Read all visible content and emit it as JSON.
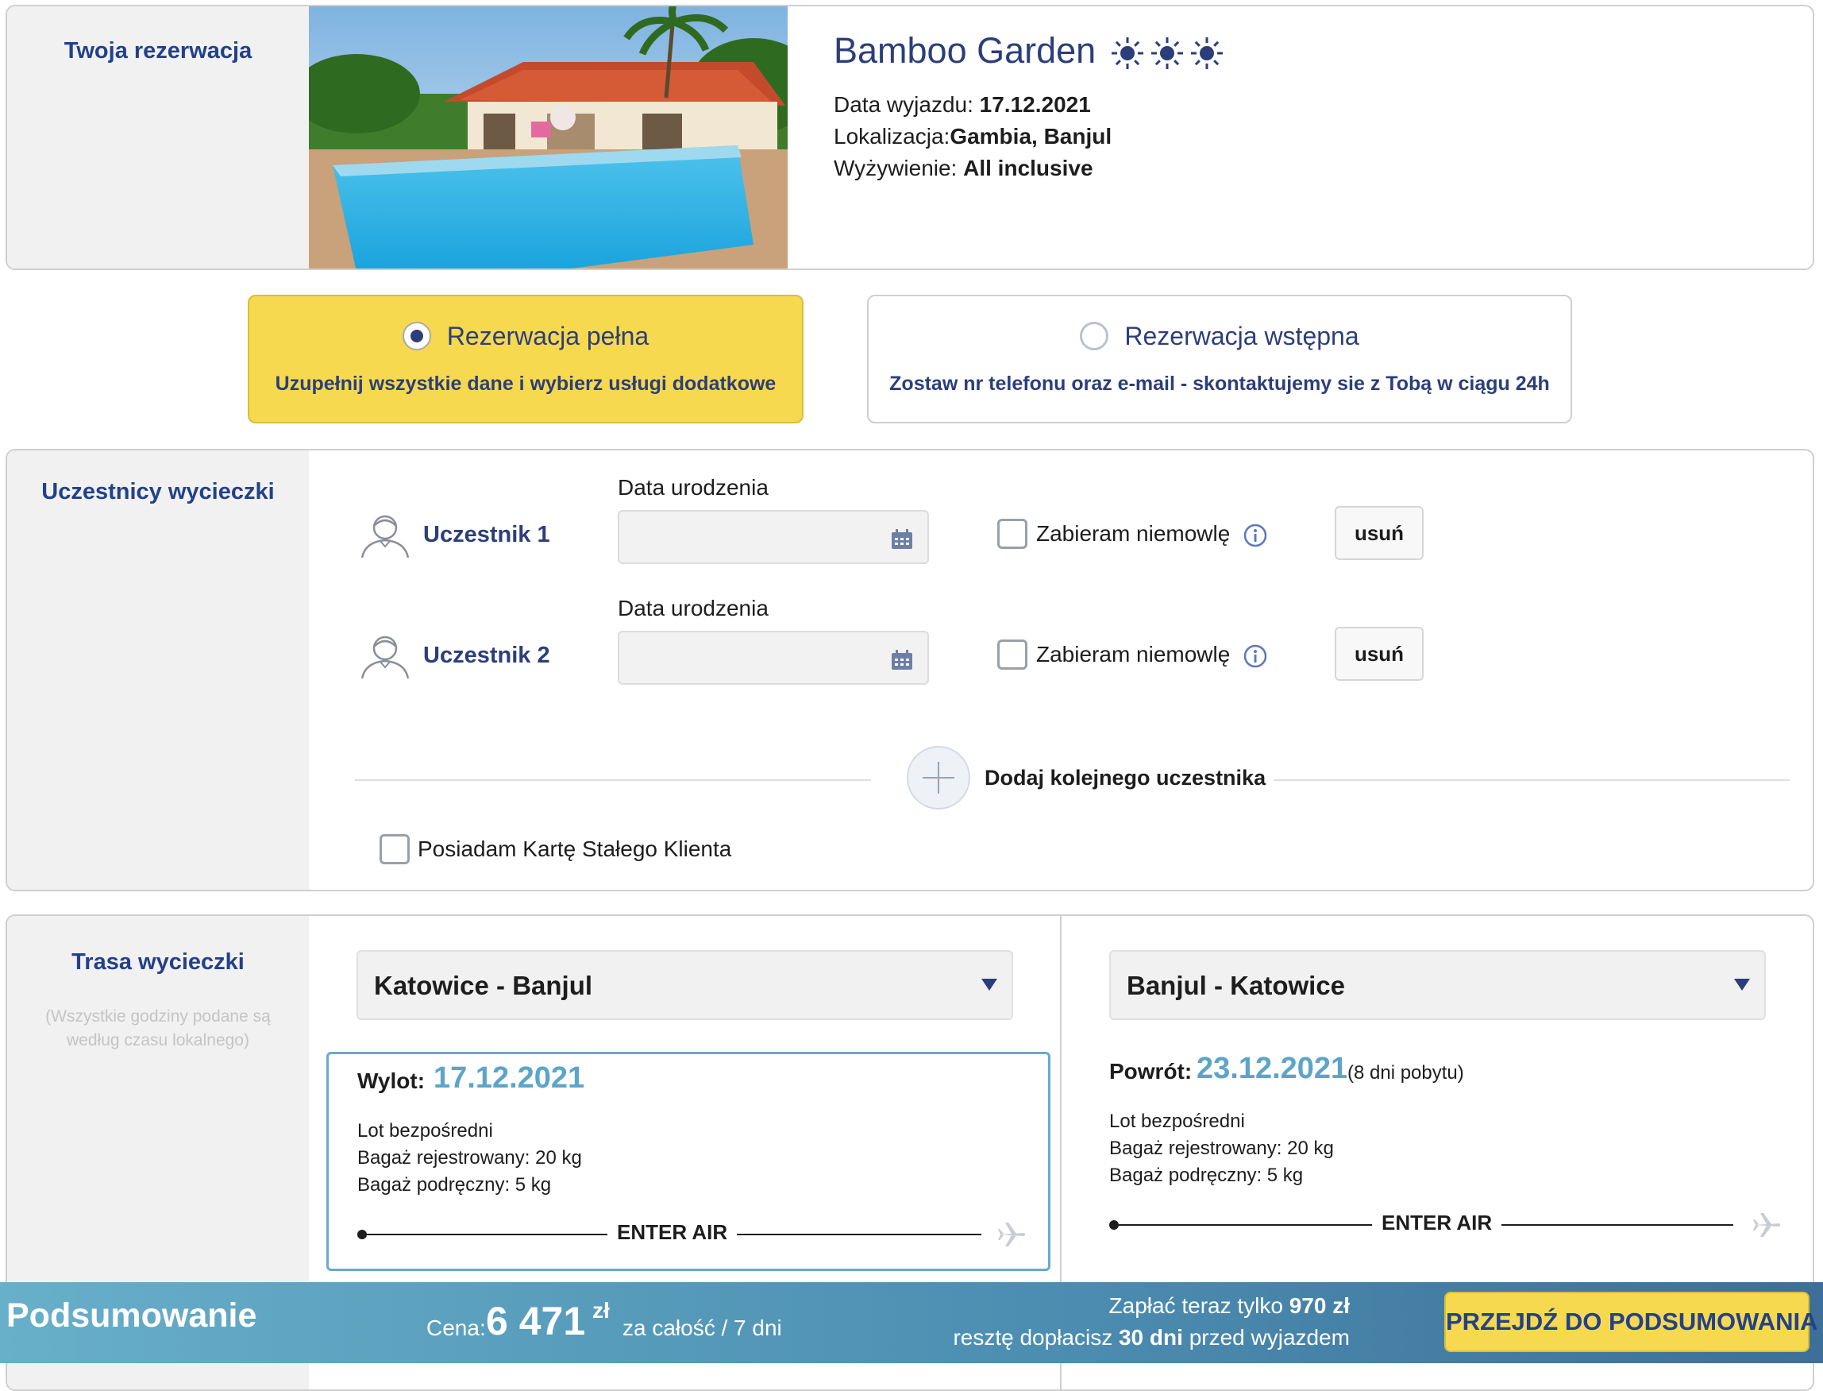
{
  "hotel": {
    "section_title": "Twoja rezerwacja",
    "name": "Bamboo Garden",
    "star_icons": [
      "sun-icon",
      "sun-icon",
      "sun-icon"
    ],
    "departure_label": "Data wyjazdu:",
    "departure_value": "17.12.2021",
    "location_label": "Lokalizacja:",
    "location_value": "Gambia, Banjul",
    "board_label": "Wyżywienie:",
    "board_value": "All inclusive"
  },
  "booking_type": {
    "full": {
      "label": "Rezerwacja pełna",
      "description": "Uzupełnij wszystkie dane i wybierz usługi dodatkowe",
      "selected": true
    },
    "preliminary": {
      "label": "Rezerwacja wstępna",
      "description": "Zostaw nr telefonu oraz e-mail - skontaktujemy sie z Tobą w ciągu 24h",
      "selected": false
    }
  },
  "participants": {
    "section_title": "Uczestnicy wycieczki",
    "items": [
      {
        "name": "Uczestnik 1",
        "dob_label": "Data urodzenia",
        "dob_value": "",
        "infant_label": "Zabieram niemowlę",
        "infant_checked": false,
        "remove_label": "usuń"
      },
      {
        "name": "Uczestnik 2",
        "dob_label": "Data urodzenia",
        "dob_value": "",
        "infant_label": "Zabieram niemowlę",
        "infant_checked": false,
        "remove_label": "usuń"
      }
    ],
    "add_label": "Dodaj kolejnego uczestnika",
    "loyalty_label": "Posiadam Kartę Stałego Klienta",
    "loyalty_checked": false
  },
  "route": {
    "section_title": "Trasa wycieczki",
    "note": "(Wszystkie godziny podane są według czasu lokalnego)",
    "outbound": {
      "select_value": "Katowice - Banjul",
      "head": "Wylot:",
      "date": "17.12.2021",
      "type": "Lot bezpośredni",
      "checked_baggage": "Bagaż rejestrowany: 20 kg",
      "hand_baggage": "Bagaż podręczny: 5 kg",
      "airline": "ENTER AIR"
    },
    "return": {
      "select_value": "Banjul - Katowice",
      "head": "Powrót:",
      "date": "23.12.2021",
      "stay": "(8 dni pobytu)",
      "type": "Lot bezpośredni",
      "checked_baggage": "Bagaż rejestrowany: 20 kg",
      "hand_baggage": "Bagaż podręczny: 5 kg",
      "airline": "ENTER AIR"
    }
  },
  "summary": {
    "title": "Podsumowanie",
    "price_label": "Cena:",
    "price_value": "6 471",
    "price_currency": "zł",
    "price_note": "za całość / 7 dni",
    "pay_now_prefix": "Zapłać teraz tylko",
    "pay_now_value": "970 zł",
    "pay_rest_prefix": "resztę dopłacisz",
    "pay_rest_value": "30 dni",
    "pay_rest_suffix": "przed wyjazdem",
    "cta_label": "PRZEJDŹ DO PODSUMOWANIA"
  },
  "colors": {
    "navy": "#2c3e7a",
    "accent_yellow": "#f7d94f",
    "date_blue": "#5da4c9",
    "summary_bar": "#4d8fb2"
  }
}
